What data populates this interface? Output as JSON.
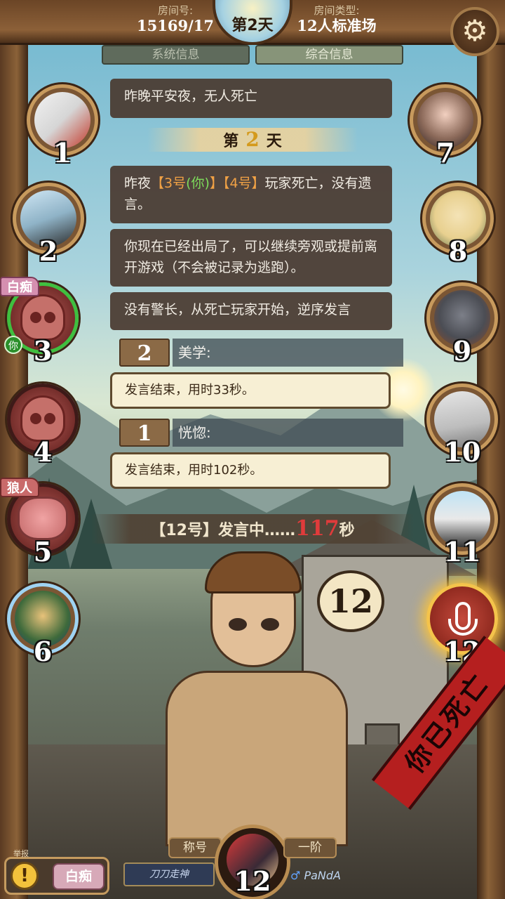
{
  "header": {
    "room_no_label": "房间号:",
    "room_no": "15169/17",
    "day": "第2天",
    "room_type_label": "房间类型:",
    "room_type": "12人标准场"
  },
  "tabs": [
    "系统信息",
    "综合信息"
  ],
  "messages": {
    "night1": "昨晚平安夜，无人死亡",
    "divider_prefix": "第",
    "divider_num": "2",
    "divider_suffix": "天",
    "death_a": "昨夜",
    "death_p3": "【3号",
    "death_you": "(你)",
    "death_p3_end": "】",
    "death_p4": "【4号】",
    "death_b": "玩家死亡，没有遗言。",
    "spectate": "你现在已经出局了，可以继续旁观或提前离开游戏（不会被记录为逃跑）。",
    "no_sheriff": "没有警长，从死亡玩家开始，逆序发言"
  },
  "speeches": [
    {
      "no": "2",
      "name": "美学:",
      "text": "发言结束，用时33秒。"
    },
    {
      "no": "1",
      "name": "恍惚:",
      "text": "发言结束，用时102秒。"
    }
  ],
  "speaking": {
    "prefix": "【12号】发言中……",
    "seconds": "117",
    "unit": "秒"
  },
  "players": [
    {
      "no": "1"
    },
    {
      "no": "2"
    },
    {
      "no": "3",
      "role": "白痴",
      "you": "你"
    },
    {
      "no": "4"
    },
    {
      "no": "5",
      "role": "狼人"
    },
    {
      "no": "6"
    },
    {
      "no": "7"
    },
    {
      "no": "8"
    },
    {
      "no": "9"
    },
    {
      "no": "10"
    },
    {
      "no": "11"
    },
    {
      "no": "12"
    }
  ],
  "speaker_bubble": "12",
  "bottom": {
    "warn_small": "举报",
    "role": "白痴",
    "title_label": "称号",
    "title": "刀刀走神",
    "rank": "一阶",
    "self_no": "12",
    "gender_symbol": "♂",
    "user_name": "PaNdA"
  },
  "dead_banner": "你已死亡"
}
